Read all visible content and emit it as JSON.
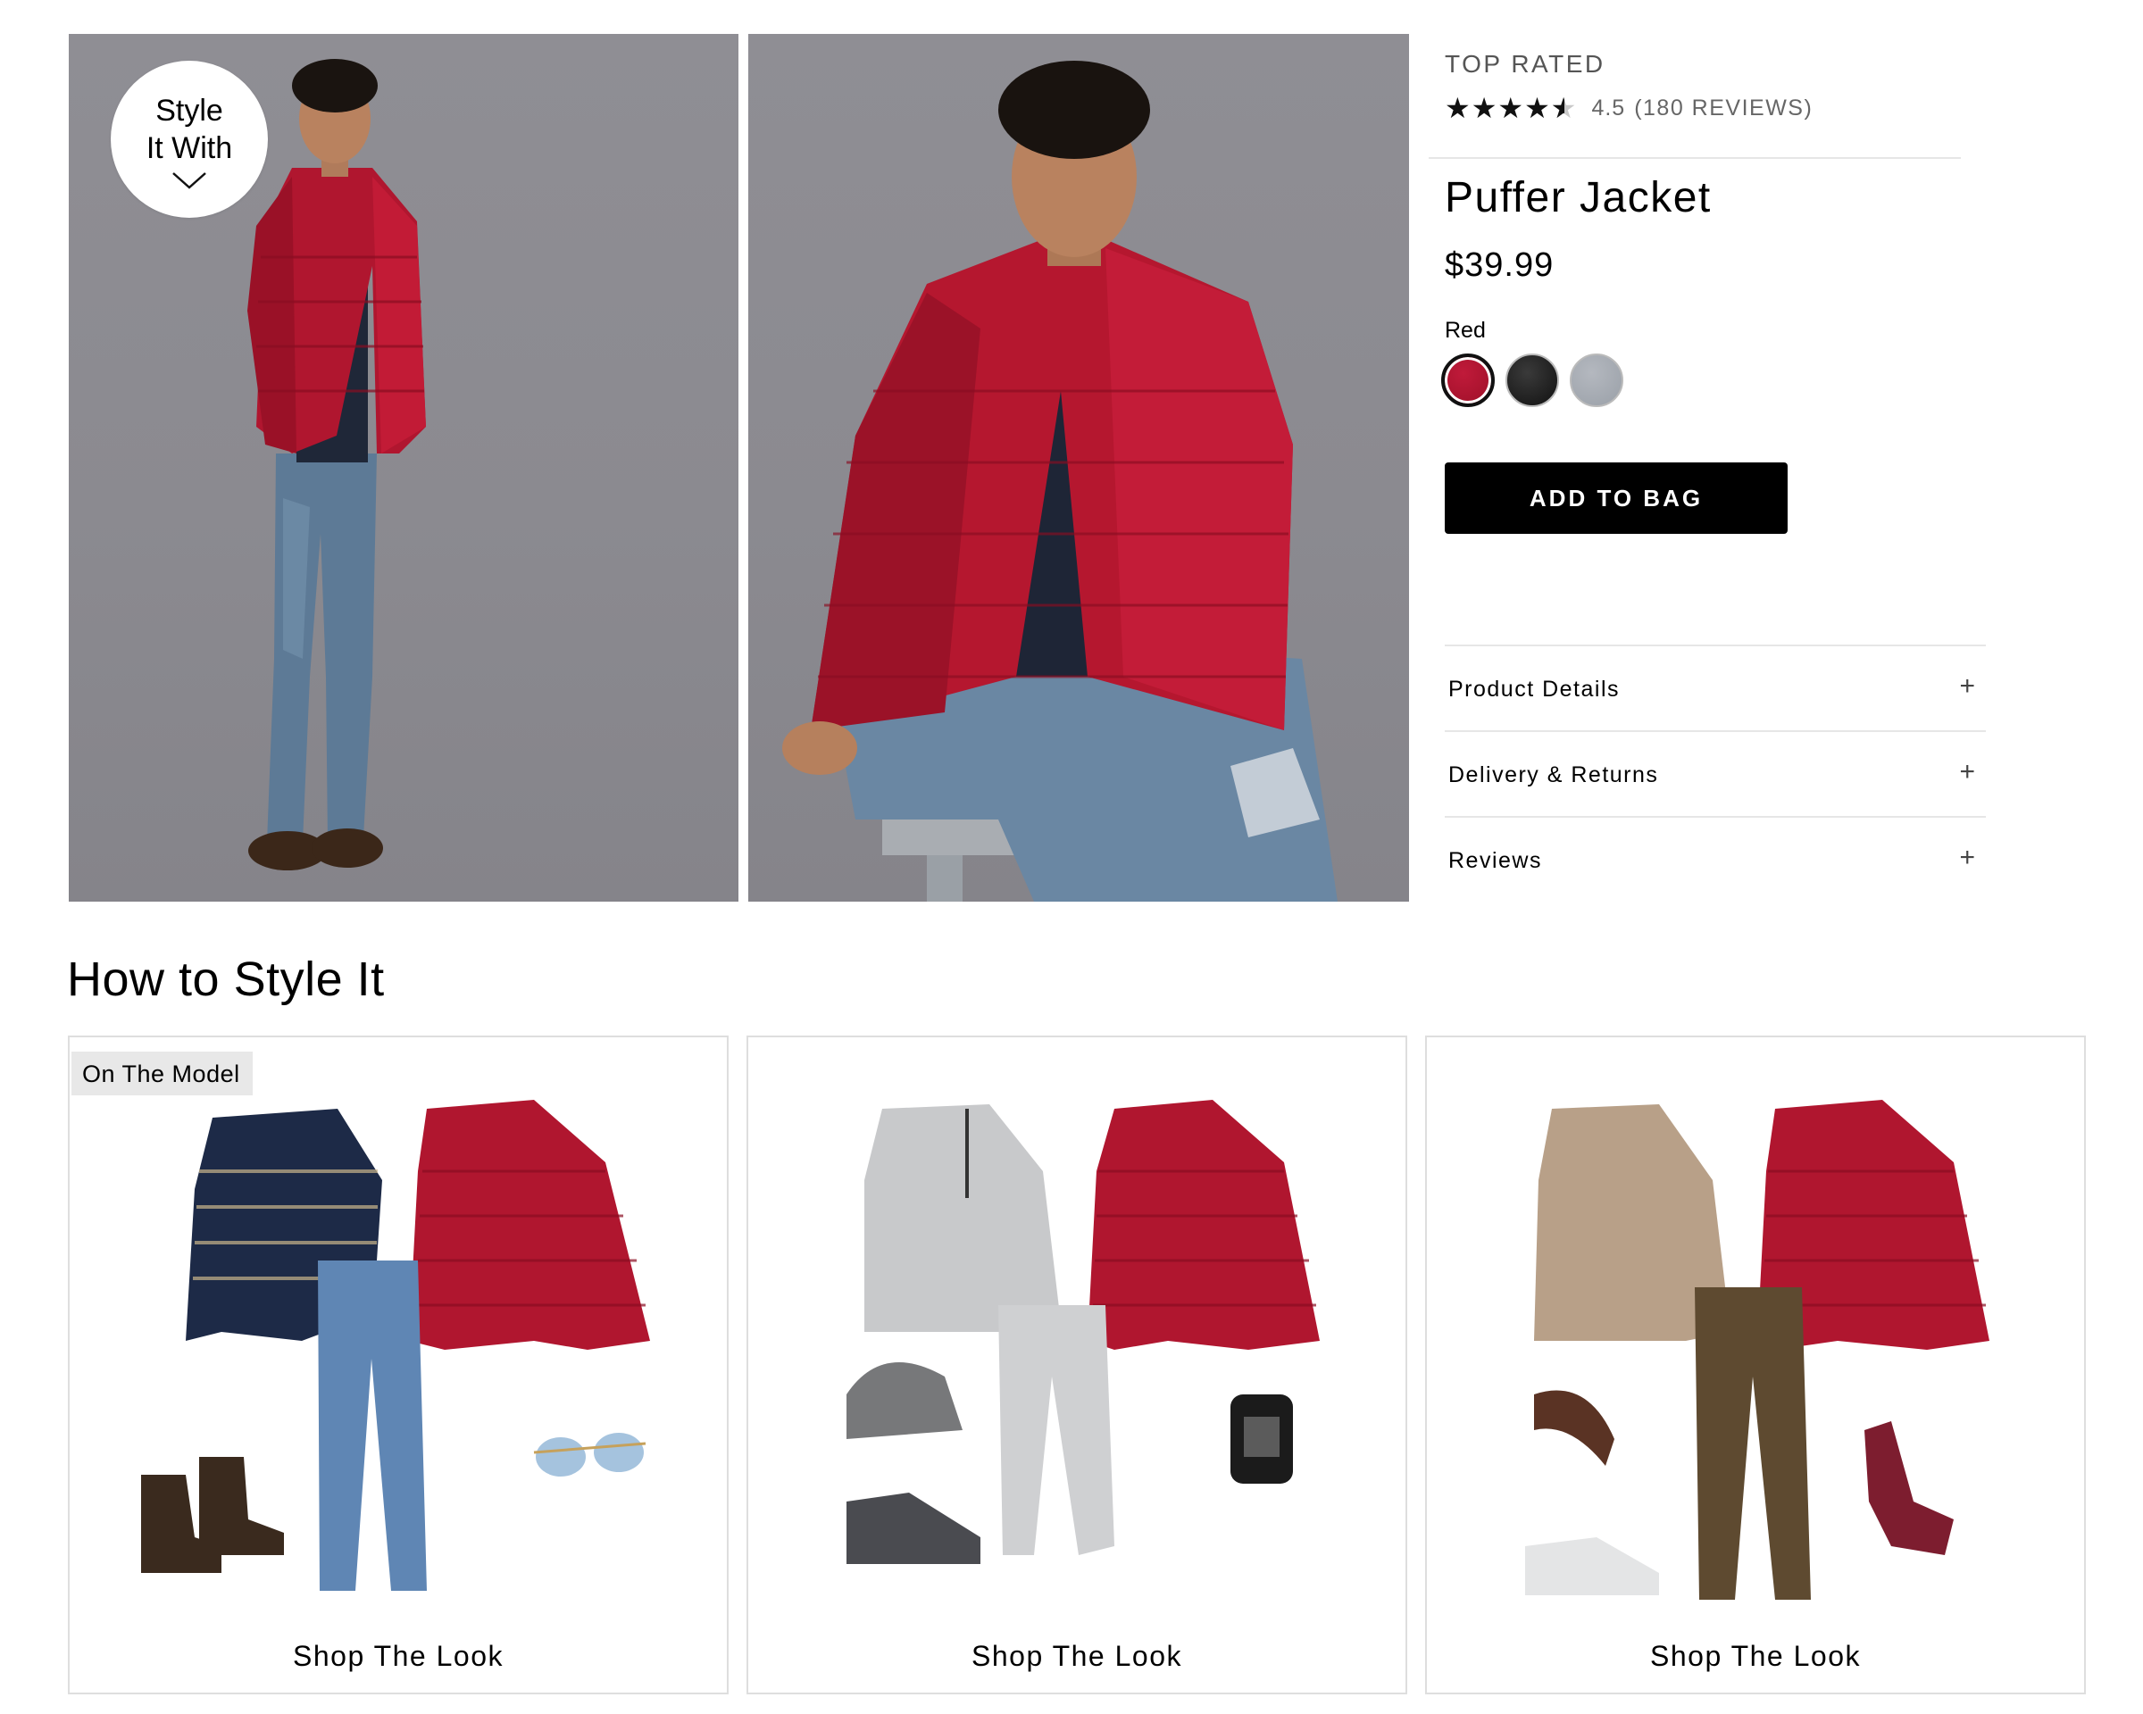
{
  "badge": {
    "line1": "Style",
    "line2": "It With"
  },
  "product": {
    "eyebrow": "TOP RATED",
    "rating": 4.5,
    "rating_text": "4.5",
    "reviews_text": "(180 REVIEWS)",
    "title": "Puffer Jacket",
    "price": "$39.99",
    "selected_color": "Red",
    "swatches": [
      {
        "name": "red",
        "hex": "#a8132f",
        "selected": true
      },
      {
        "name": "black",
        "hex": "#222222",
        "selected": false
      },
      {
        "name": "gray",
        "hex": "#a6abb2",
        "selected": false
      }
    ],
    "add_to_bag": "ADD TO BAG"
  },
  "accordion": [
    {
      "label": "Product Details",
      "icon": "plus-icon"
    },
    {
      "label": "Delivery & Returns",
      "icon": "plus-icon"
    },
    {
      "label": "Reviews",
      "icon": "plus-icon"
    }
  ],
  "style_section": {
    "title": "How to Style It",
    "looks": [
      {
        "tag": "On The Model",
        "cta": "Shop The Look"
      },
      {
        "tag": "",
        "cta": "Shop The Look"
      },
      {
        "tag": "",
        "cta": "Shop The Look"
      }
    ]
  }
}
